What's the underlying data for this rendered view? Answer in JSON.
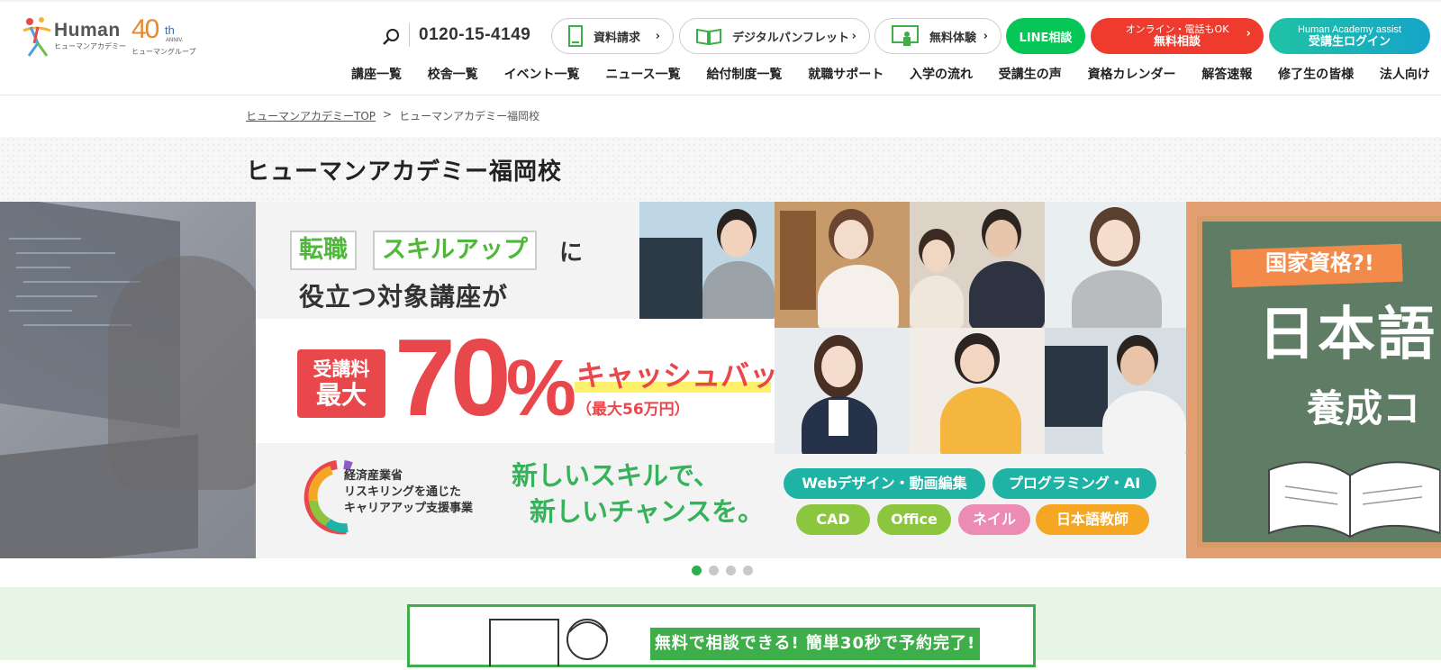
{
  "header": {
    "logo": {
      "en": "Human",
      "ja": "ヒューマンアカデミー"
    },
    "anniversary": {
      "number": "40",
      "suffix": "th",
      "sub": "ANNIV.",
      "group": "ヒューマングループ"
    },
    "phone": "0120-15-4149",
    "buttons": {
      "request": "資料請求",
      "pamphlet": "デジタルパンフレット",
      "trial": "無料体験",
      "line": "LINE相談",
      "consult_small": "オンライン・電話もOK",
      "consult_main": "無料相談",
      "assist_small": "Human Academy assist",
      "assist_main": "受講生ログイン"
    },
    "nav": [
      "講座一覧",
      "校舎一覧",
      "イベント一覧",
      "ニュース一覧",
      "給付制度一覧",
      "就職サポート",
      "入学の流れ",
      "受講生の声",
      "資格カレンダー",
      "解答速報",
      "修了生の皆様",
      "法人向け"
    ]
  },
  "breadcrumb": {
    "home": "ヒューマンアカデミーTOP",
    "separator": ">",
    "current": "ヒューマンアカデミー福岡校"
  },
  "page_title": "ヒューマンアカデミー福岡校",
  "hero": {
    "tag1": "転職",
    "tag2": "スキルアップ",
    "tag_suffix": "に",
    "line2": "役立つ対象講座が",
    "fee_a": "受講料",
    "fee_b": "最大",
    "percent_num": "70",
    "percent_sign": "%",
    "cashback": "キャッシュバック",
    "max_amount": "（最大56万円）",
    "meti": [
      "経済産業省",
      "リスキリングを通じた",
      "キャリアアップ支援事業"
    ],
    "slogan": [
      "新しいスキルで、",
      "新しいチャンスを。"
    ],
    "chips": [
      {
        "label": "Webデザイン・動画編集",
        "color": "#1fb3a6"
      },
      {
        "label": "プログラミング・AI",
        "color": "#1fb3a6"
      },
      {
        "label": "CAD",
        "color": "#8cc63f"
      },
      {
        "label": "Office",
        "color": "#8cc63f"
      },
      {
        "label": "ネイル",
        "color": "#ec8bb4"
      },
      {
        "label": "日本語教師",
        "color": "#f5a623"
      }
    ],
    "right": {
      "banner": "国家資格?!",
      "big": "日本語",
      "mid": "養成コ"
    }
  },
  "carousel": {
    "count": 4,
    "active": 0
  },
  "consult": {
    "text": "無料で相談できる! 簡単30秒で予約完了!"
  },
  "colors": {
    "green": "#3dae4a",
    "red": "#e8484b",
    "line": "#06c755",
    "teal": "#1fb3a6"
  }
}
